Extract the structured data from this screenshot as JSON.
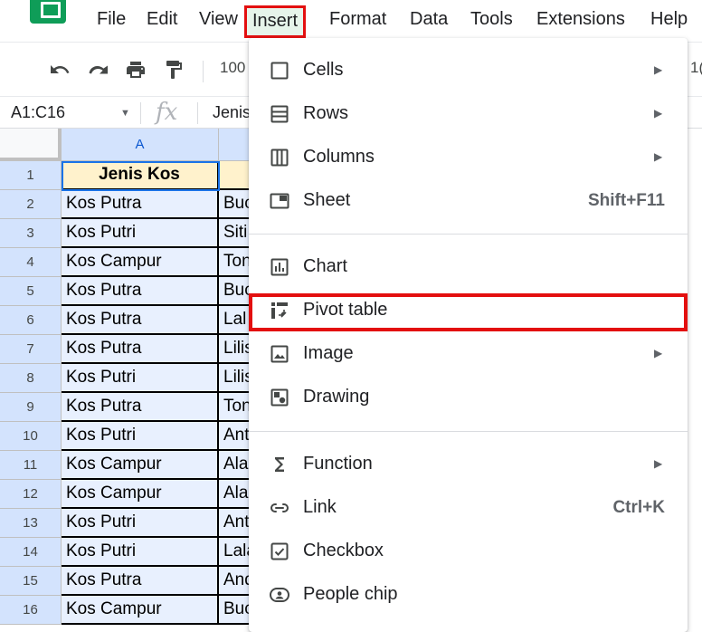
{
  "menubar": {
    "items": [
      "File",
      "Edit",
      "View",
      "Insert",
      "Format",
      "Data",
      "Tools",
      "Extensions",
      "Help"
    ],
    "active": "Insert"
  },
  "toolbar": {
    "zoom_partial": "100",
    "right_partial": "1("
  },
  "formula_bar": {
    "name_box": "A1:C16",
    "fx": "fx",
    "content_partial": "Jenis"
  },
  "sheet": {
    "col_a_header": "A",
    "rows": [
      {
        "num": "1",
        "a": "Jenis Kos",
        "b": ""
      },
      {
        "num": "2",
        "a": "Kos Putra",
        "b": "Buc"
      },
      {
        "num": "3",
        "a": "Kos Putri",
        "b": "Siti"
      },
      {
        "num": "4",
        "a": "Kos Campur",
        "b": "Ton"
      },
      {
        "num": "5",
        "a": "Kos Putra",
        "b": "Buc"
      },
      {
        "num": "6",
        "a": "Kos Putra",
        "b": "Lal"
      },
      {
        "num": "7",
        "a": "Kos Putra",
        "b": "Lilis"
      },
      {
        "num": "8",
        "a": "Kos Putri",
        "b": "Lilis"
      },
      {
        "num": "9",
        "a": "Kos Putra",
        "b": "Ton"
      },
      {
        "num": "10",
        "a": "Kos Putri",
        "b": "Ant"
      },
      {
        "num": "11",
        "a": "Kos Campur",
        "b": "Ala"
      },
      {
        "num": "12",
        "a": "Kos Campur",
        "b": "Ala"
      },
      {
        "num": "13",
        "a": "Kos Putri",
        "b": "Ant"
      },
      {
        "num": "14",
        "a": "Kos Putri",
        "b": "Lala"
      },
      {
        "num": "15",
        "a": "Kos Putra",
        "b": "And"
      },
      {
        "num": "16",
        "a": "Kos Campur",
        "b": "Buc"
      }
    ]
  },
  "insert_menu": {
    "items": [
      {
        "label": "Cells",
        "icon": "cells-icon",
        "submenu": true,
        "shortcut": ""
      },
      {
        "label": "Rows",
        "icon": "rows-icon",
        "submenu": true,
        "shortcut": ""
      },
      {
        "label": "Columns",
        "icon": "columns-icon",
        "submenu": true,
        "shortcut": ""
      },
      {
        "label": "Sheet",
        "icon": "sheet-icon",
        "submenu": false,
        "shortcut": "Shift+F11"
      },
      {
        "label": "Chart",
        "icon": "chart-icon",
        "submenu": false,
        "shortcut": ""
      },
      {
        "label": "Pivot table",
        "icon": "pivot-table-icon",
        "submenu": false,
        "shortcut": ""
      },
      {
        "label": "Image",
        "icon": "image-icon",
        "submenu": true,
        "shortcut": ""
      },
      {
        "label": "Drawing",
        "icon": "drawing-icon",
        "submenu": false,
        "shortcut": ""
      },
      {
        "label": "Function",
        "icon": "sigma-icon",
        "submenu": true,
        "shortcut": ""
      },
      {
        "label": "Link",
        "icon": "link-icon",
        "submenu": false,
        "shortcut": "Ctrl+K"
      },
      {
        "label": "Checkbox",
        "icon": "checkbox-icon",
        "submenu": false,
        "shortcut": ""
      },
      {
        "label": "People chip",
        "icon": "people-chip-icon",
        "submenu": false,
        "shortcut": ""
      }
    ],
    "highlighted": "Pivot table"
  },
  "colors": {
    "highlight_border": "#e30f0f",
    "selection_fill": "#e8f0fe",
    "header_cell_fill": "#fff2cc",
    "sheets_green": "#0f9d58"
  }
}
